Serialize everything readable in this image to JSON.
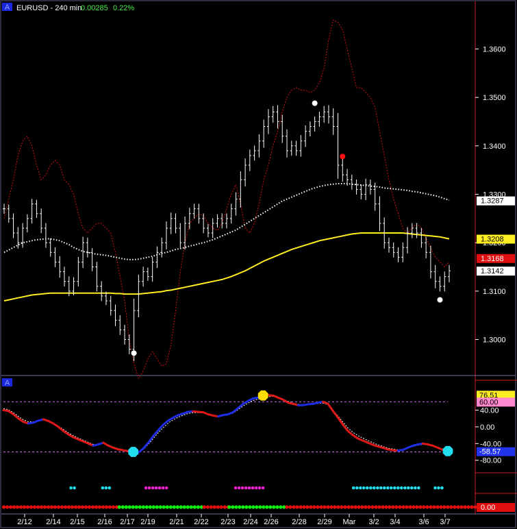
{
  "header": {
    "badge": "A",
    "symbol_label": "EURUSD - 240 min",
    "change": "0.00285",
    "change_pct": "0.22%"
  },
  "colors": {
    "background": "#000000",
    "price_bars": "#ffffff",
    "band": "#d01010",
    "ma_fast": "#ffffff",
    "ma_slow": "#ffee22",
    "osc_up": "#1f2ee6",
    "osc_down": "#e01818",
    "osc_signal": "#ffffff",
    "dot_cyan": "#22ddee",
    "dot_magenta": "#ee22cc",
    "strip_red": "#e01010",
    "strip_green": "#10ee10",
    "level_line": "#cc66ee",
    "marker_red": "#ff1010",
    "marker_white": "#ffffff",
    "marker_yellow": "#ffdd00"
  },
  "chart_data": [
    {
      "type": "bar",
      "name_on_chart": "EURUSD - 240 min",
      "price_axis_ticks": [
        1.3,
        1.31,
        1.32,
        1.33,
        1.34,
        1.35,
        1.36
      ],
      "price_axis_tick_labels": [
        "1.3000",
        "1.3100",
        "1.3200",
        "1.3300",
        "1.3400",
        "1.3500",
        "1.3600"
      ],
      "ylim": [
        1.293,
        1.367
      ],
      "price_tags": [
        {
          "label": "1.3287",
          "value": 1.3287,
          "bg": "#ffffff",
          "fg": "#000000"
        },
        {
          "label": "1.3208",
          "value": 1.3208,
          "bg": "#ffee22",
          "fg": "#000000"
        },
        {
          "label": "1.3168",
          "value": 1.3168,
          "bg": "#e01010",
          "fg": "#ffffff"
        },
        {
          "label": "1.3142",
          "value": 1.3142,
          "bg": "#ffffff",
          "fg": "#000000"
        }
      ],
      "close_series": [
        1.327,
        1.325,
        1.322,
        1.32,
        1.323,
        1.325,
        1.328,
        1.326,
        1.323,
        1.32,
        1.318,
        1.316,
        1.314,
        1.312,
        1.31,
        1.312,
        1.316,
        1.32,
        1.318,
        1.315,
        1.311,
        1.309,
        1.308,
        1.306,
        1.304,
        1.302,
        1.3,
        1.298,
        1.306,
        1.312,
        1.314,
        1.313,
        1.316,
        1.318,
        1.32,
        1.323,
        1.325,
        1.323,
        1.32,
        1.324,
        1.326,
        1.327,
        1.325,
        1.323,
        1.322,
        1.324,
        1.325,
        1.324,
        1.325,
        1.327,
        1.329,
        1.333,
        1.336,
        1.338,
        1.339,
        1.341,
        1.344,
        1.346,
        1.347,
        1.345,
        1.342,
        1.339,
        1.34,
        1.339,
        1.341,
        1.343,
        1.344,
        1.345,
        1.346,
        1.347,
        1.346,
        1.344,
        1.336,
        1.334,
        1.333,
        1.332,
        1.331,
        1.33,
        1.332,
        1.331,
        1.328,
        1.324,
        1.32,
        1.319,
        1.318,
        1.317,
        1.319,
        1.322,
        1.323,
        1.322,
        1.32,
        1.318,
        1.314,
        1.312,
        1.311,
        1.313,
        1.3142
      ],
      "range_series": [
        0.003,
        0.0025,
        0.003,
        0.0035,
        0.003,
        0.0025,
        0.003,
        0.0025,
        0.003,
        0.003,
        0.0025,
        0.003,
        0.0035,
        0.003,
        0.003,
        0.0025,
        0.003,
        0.0035,
        0.003,
        0.0025,
        0.003,
        0.003,
        0.0025,
        0.003,
        0.0035,
        0.003,
        0.003,
        0.003,
        0.007,
        0.004,
        0.003,
        0.0025,
        0.003,
        0.0035,
        0.003,
        0.004,
        0.0035,
        0.003,
        0.003,
        0.004,
        0.0035,
        0.003,
        0.003,
        0.003,
        0.0025,
        0.003,
        0.0025,
        0.003,
        0.003,
        0.003,
        0.004,
        0.005,
        0.004,
        0.0035,
        0.003,
        0.004,
        0.004,
        0.0045,
        0.0035,
        0.004,
        0.004,
        0.004,
        0.003,
        0.003,
        0.0035,
        0.0035,
        0.003,
        0.003,
        0.003,
        0.0035,
        0.004,
        0.005,
        0.008,
        0.004,
        0.0035,
        0.003,
        0.003,
        0.003,
        0.0035,
        0.003,
        0.004,
        0.0045,
        0.0035,
        0.003,
        0.003,
        0.003,
        0.003,
        0.0035,
        0.003,
        0.003,
        0.003,
        0.0035,
        0.004,
        0.004,
        0.003,
        0.003,
        0.0035
      ],
      "ma_fast": [
        1.318,
        1.3185,
        1.319,
        1.3195,
        1.32,
        1.3202,
        1.3204,
        1.3206,
        1.3207,
        1.3208,
        1.3208,
        1.3206,
        1.3204,
        1.32,
        1.3196,
        1.319,
        1.3186,
        1.3182,
        1.318,
        1.3178,
        1.3176,
        1.3175,
        1.3174,
        1.3172,
        1.317,
        1.3168,
        1.3166,
        1.3165,
        1.3165,
        1.3166,
        1.3168,
        1.317,
        1.3172,
        1.3175,
        1.3178,
        1.318,
        1.3183,
        1.3186,
        1.3188,
        1.319,
        1.3193,
        1.3195,
        1.3198,
        1.32,
        1.3203,
        1.3206,
        1.321,
        1.3214,
        1.3218,
        1.3222,
        1.3226,
        1.3232,
        1.3238,
        1.3244,
        1.325,
        1.3256,
        1.3262,
        1.3268,
        1.3274,
        1.328,
        1.3286,
        1.329,
        1.3294,
        1.3298,
        1.3302,
        1.3306,
        1.331,
        1.3313,
        1.3316,
        1.3318,
        1.332,
        1.3321,
        1.3322,
        1.3322,
        1.3322,
        1.3321,
        1.332,
        1.3319,
        1.3318,
        1.3317,
        1.3316,
        1.3315,
        1.3313,
        1.3312,
        1.3311,
        1.331,
        1.3309,
        1.3308,
        1.3306,
        1.3305,
        1.3303,
        1.3301,
        1.3299,
        1.3297,
        1.3294,
        1.3291,
        1.3288
      ],
      "ma_slow": [
        1.308,
        1.3082,
        1.3084,
        1.3086,
        1.3088,
        1.309,
        1.3092,
        1.3093,
        1.3094,
        1.3095,
        1.3096,
        1.3096,
        1.3096,
        1.3096,
        1.3096,
        1.3096,
        1.3096,
        1.3096,
        1.3096,
        1.3096,
        1.3096,
        1.3096,
        1.3096,
        1.3096,
        1.3095,
        1.3095,
        1.3094,
        1.3094,
        1.3094,
        1.3094,
        1.3095,
        1.3096,
        1.3097,
        1.3098,
        1.3099,
        1.3101,
        1.3102,
        1.3104,
        1.3106,
        1.3108,
        1.311,
        1.3112,
        1.3114,
        1.3116,
        1.3118,
        1.312,
        1.3122,
        1.3124,
        1.3127,
        1.313,
        1.3134,
        1.3138,
        1.3142,
        1.3147,
        1.3152,
        1.3157,
        1.3162,
        1.3166,
        1.317,
        1.3174,
        1.3178,
        1.3182,
        1.3186,
        1.3189,
        1.3192,
        1.3195,
        1.3198,
        1.3201,
        1.3204,
        1.3206,
        1.3208,
        1.321,
        1.3212,
        1.3214,
        1.3216,
        1.3218,
        1.3219,
        1.322,
        1.322,
        1.322,
        1.322,
        1.322,
        1.322,
        1.322,
        1.322,
        1.322,
        1.322,
        1.3219,
        1.3218,
        1.3217,
        1.3216,
        1.3215,
        1.3214,
        1.3213,
        1.3212,
        1.321,
        1.3208
      ],
      "band_series": [
        1.325,
        1.329,
        1.333,
        1.338,
        1.341,
        1.342,
        1.34,
        1.336,
        1.333,
        1.334,
        1.336,
        1.337,
        1.336,
        1.333,
        1.332,
        1.33,
        1.326,
        1.323,
        1.322,
        1.323,
        1.324,
        1.324,
        1.323,
        1.322,
        1.318,
        1.313,
        1.308,
        1.3,
        1.295,
        1.292,
        1.2935,
        1.296,
        1.2975,
        1.296,
        1.2945,
        1.295,
        1.299,
        1.306,
        1.314,
        1.32,
        1.324,
        1.325,
        1.326,
        1.3255,
        1.324,
        1.323,
        1.3225,
        1.324,
        1.327,
        1.33,
        1.332,
        1.328,
        1.323,
        1.322,
        1.324,
        1.328,
        1.333,
        1.336,
        1.34,
        1.343,
        1.347,
        1.35,
        1.3515,
        1.352,
        1.3515,
        1.3515,
        1.351,
        1.3515,
        1.353,
        1.356,
        1.362,
        1.366,
        1.3655,
        1.364,
        1.36,
        1.356,
        1.352,
        1.352,
        1.351,
        1.35,
        1.348,
        1.343,
        1.338,
        1.333,
        1.329,
        1.326,
        1.323,
        1.322,
        1.323,
        1.324,
        1.323,
        1.321,
        1.319,
        1.317,
        1.316,
        1.315,
        1.316
      ],
      "markers": [
        {
          "x_index": 28,
          "y": 1.2972,
          "color": "#ffffff"
        },
        {
          "x_index": 67,
          "y": 1.3488,
          "color": "#ffffff"
        },
        {
          "x_index": 73,
          "y": 1.3378,
          "color": "#ff1010"
        },
        {
          "x_index": 94,
          "y": 1.3082,
          "color": "#ffffff"
        }
      ],
      "x_tick_labels": [
        "2/12",
        "2/14",
        "2/15",
        "2/16",
        "2/17",
        "2/19",
        "2/21",
        "2/22",
        "2/23",
        "2/24",
        "2/26",
        "2/28",
        "2/29",
        "Mar",
        "3/2",
        "3/4",
        "3/6",
        "3/7"
      ],
      "x_tick_indices": [
        5,
        12,
        18,
        25,
        30,
        36,
        43,
        49,
        55,
        61,
        67,
        74,
        80,
        86,
        93,
        98,
        105,
        110
      ]
    },
    {
      "type": "line",
      "badge": "A",
      "osc_axis_ticks": [
        40,
        0,
        -40,
        -80
      ],
      "osc_axis_tick_labels": [
        "40.00",
        "0.00",
        "-40.00",
        "-80.00"
      ],
      "ylim": [
        -110,
        95
      ],
      "level_lines": [
        60,
        -60
      ],
      "value_tags": [
        {
          "label": "76.51",
          "value": 76.51,
          "bg": "#ffee22",
          "fg": "#000000"
        },
        {
          "label": "60.00",
          "value": 60.0,
          "bg": "#ff88cc",
          "fg": "#000000"
        },
        {
          "label": "-58.57",
          "value": -58.57,
          "bg": "#2233ee",
          "fg": "#ffffff"
        }
      ],
      "osc_series": [
        40,
        38,
        30,
        20,
        12,
        8,
        10,
        15,
        18,
        14,
        8,
        0,
        -10,
        -18,
        -25,
        -30,
        -35,
        -40,
        -45,
        -42,
        -38,
        -45,
        -50,
        -54,
        -56,
        -58,
        -60,
        -62,
        -52,
        -38,
        -22,
        -8,
        5,
        15,
        22,
        28,
        32,
        36,
        37,
        36,
        35,
        30,
        27,
        25,
        28,
        30,
        35,
        45,
        55,
        62,
        68,
        70,
        72,
        76,
        75,
        70,
        65,
        58,
        55,
        52,
        52,
        54,
        55,
        58,
        60,
        55,
        38,
        22,
        5,
        -10,
        -20,
        -28,
        -33,
        -38,
        -43,
        -47,
        -50,
        -54,
        -56,
        -57,
        -55,
        -50,
        -45,
        -42,
        -40,
        -42,
        -45,
        -50,
        -55,
        -58
      ],
      "signal_series": [
        44,
        41,
        34,
        25,
        17,
        12,
        12,
        14,
        16,
        14,
        9,
        2,
        -6,
        -14,
        -21,
        -27,
        -32,
        -37,
        -42,
        -42,
        -40,
        -43,
        -48,
        -52,
        -55,
        -57,
        -59,
        -60,
        -54,
        -42,
        -28,
        -14,
        -2,
        9,
        17,
        23,
        28,
        32,
        34,
        34,
        34,
        31,
        28,
        26,
        27,
        29,
        33,
        41,
        50,
        57,
        63,
        66,
        69,
        72,
        73,
        70,
        66,
        61,
        57,
        54,
        53,
        53,
        54,
        56,
        57,
        53,
        40,
        26,
        11,
        -3,
        -13,
        -21,
        -27,
        -33,
        -38,
        -43,
        -47,
        -51,
        -53,
        -55,
        -54,
        -51,
        -47,
        -44,
        -42,
        -43,
        -45,
        -49,
        -53,
        -57
      ],
      "extreme_markers": [
        {
          "x_index": 26,
          "y": -60,
          "color": "#22ddee"
        },
        {
          "x_index": 52,
          "y": 75,
          "color": "#ffdd00"
        },
        {
          "x_index": 89,
          "y": -58,
          "color": "#22ddee"
        }
      ]
    },
    {
      "type": "scatter",
      "dot_runs": [
        {
          "from": 0.146,
          "to": 0.154,
          "color": "#22ddee"
        },
        {
          "from": 0.213,
          "to": 0.23,
          "color": "#22ddee"
        },
        {
          "from": 0.305,
          "to": 0.35,
          "color": "#ee22cc"
        },
        {
          "from": 0.495,
          "to": 0.555,
          "color": "#ee22cc"
        },
        {
          "from": 0.745,
          "to": 0.885,
          "color": "#22ddee"
        },
        {
          "from": 0.918,
          "to": 0.935,
          "color": "#22ddee"
        }
      ],
      "strip_segments": [
        {
          "from": 0.0,
          "to": 0.245,
          "color": "#e01010"
        },
        {
          "from": 0.245,
          "to": 0.425,
          "color": "#10ee10"
        },
        {
          "from": 0.425,
          "to": 0.478,
          "color": "#e01010"
        },
        {
          "from": 0.478,
          "to": 0.6,
          "color": "#10ee10"
        },
        {
          "from": 0.6,
          "to": 1.0,
          "color": "#e01010"
        }
      ],
      "strip_tag": "0.00"
    }
  ]
}
